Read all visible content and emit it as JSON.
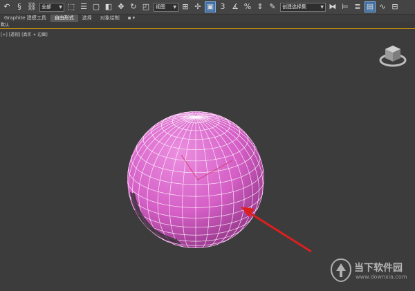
{
  "toolbar": {
    "selection_filter": "全部",
    "reference_coord": "视图",
    "named_selection": "创建选择集",
    "snap_label": "3",
    "percent_snap": "%",
    "icons": [
      "undo-icon",
      "redo-icon",
      "link-icon",
      "select-filter-dropdown",
      "select-object-icon",
      "select-by-name-icon",
      "rect-select-icon",
      "window-crossing-icon",
      "move-icon",
      "rotate-icon",
      "scale-icon",
      "ref-coord-dropdown",
      "pivot-icon",
      "select-manipulate-icon",
      "keyboard-shortcut-icon",
      "snap-toggle-icon",
      "angle-snap-icon",
      "percent-snap-icon",
      "spinner-snap-icon",
      "edit-named-sel-icon",
      "named-selection-dropdown",
      "mirror-icon",
      "align-icon",
      "layer-icon",
      "graphite-toggle-icon",
      "curve-editor-icon",
      "schematic-icon"
    ]
  },
  "ribbon": {
    "tabs": [
      {
        "label": "Graphite 建模工具",
        "selected": false
      },
      {
        "label": "自由形式",
        "selected": true
      },
      {
        "label": "选择",
        "selected": false
      },
      {
        "label": "对象绘制",
        "selected": false
      }
    ],
    "extra": "▪ ▾"
  },
  "panel": {
    "label": "默认"
  },
  "viewport": {
    "label": "[+] [透视] [真实 + 边面]",
    "object": "sphere",
    "object_color": "#d55fc6",
    "wire_color": "#ffffff",
    "arrow_color": "#dc1f1f"
  },
  "watermark": {
    "name": "当下软件园",
    "url": "www.downxia.com"
  }
}
